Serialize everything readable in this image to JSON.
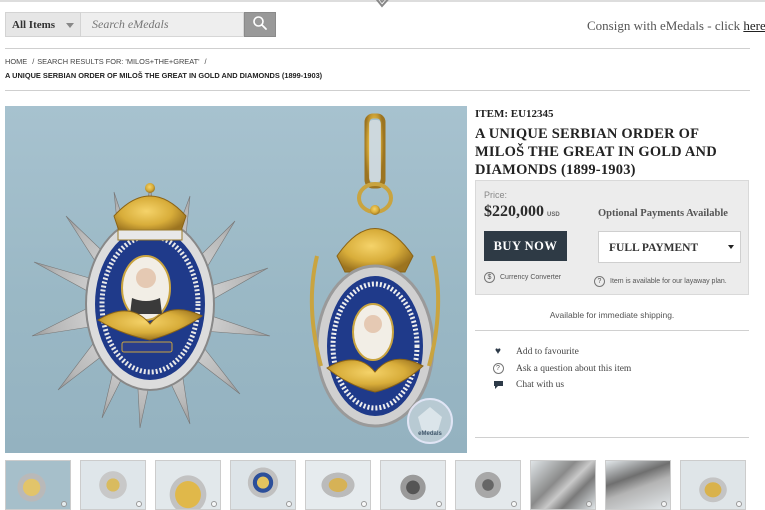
{
  "search": {
    "category": "All Items",
    "placeholder": "Search eMedals"
  },
  "header": {
    "consign_text": "Consign with eMedals - click ",
    "consign_link": "here",
    "consign_end": "."
  },
  "breadcrumb": {
    "home": "HOME",
    "results": "SEARCH RESULTS FOR: 'MILOS+THE+GREAT'",
    "current": "A UNIQUE SERBIAN ORDER OF MILOŠ THE GREAT IN GOLD AND DIAMONDS (1899-1903)"
  },
  "item": {
    "id_label": "ITEM: EU12345",
    "title": "A UNIQUE SERBIAN ORDER OF MILOŠ THE GREAT IN GOLD AND DIAMONDS (1899-1903)"
  },
  "price": {
    "label": "Price:",
    "amount": "$220,000",
    "currency": "USD",
    "optional_label": "Optional Payments Available",
    "buy_label": "BUY NOW",
    "payment_option": "FULL PAYMENT",
    "currency_converter": "Currency Converter",
    "layaway_note": "Item is available for our layaway plan.",
    "shipping": "Available for immediate shipping."
  },
  "actions": [
    {
      "label": "Add to favourite",
      "icon": "heart-icon"
    },
    {
      "label": "Ask a question about this item",
      "icon": "question-icon"
    },
    {
      "label": "Chat with us",
      "icon": "chat-icon"
    }
  ],
  "photo": {
    "watermark": "eMedals"
  },
  "thumbnails": [
    {
      "label": "thumb-1"
    },
    {
      "label": "thumb-2"
    },
    {
      "label": "thumb-3"
    },
    {
      "label": "thumb-4"
    },
    {
      "label": "thumb-5"
    },
    {
      "label": "thumb-6"
    },
    {
      "label": "thumb-7"
    },
    {
      "label": "thumb-8"
    },
    {
      "label": "thumb-9"
    },
    {
      "label": "thumb-10"
    }
  ],
  "colors": {
    "buy_button": "#2e3a45",
    "photo_background": "#a7c2cf",
    "gold": "#d8ad3a"
  }
}
